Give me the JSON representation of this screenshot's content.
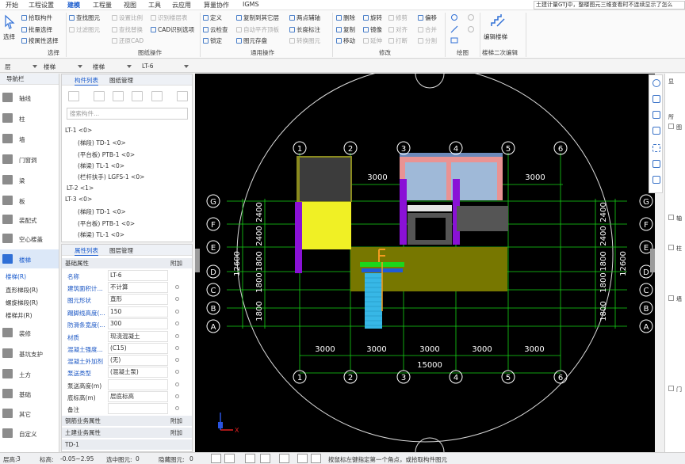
{
  "menu": {
    "tabs": [
      "开始",
      "工程设置",
      "建模",
      "工程量",
      "视图",
      "工具",
      "云应用",
      "算量协作",
      "IGMS"
    ],
    "active": "建模",
    "notice": "土建计量GTJ中，整楼图元三维查看时不连续显示了怎么"
  },
  "ribbon": {
    "select": {
      "big": "选择",
      "items": [
        "拾取构件",
        "批量选择",
        "按属性选择"
      ],
      "label": "选择"
    },
    "drawing": {
      "items": [
        "查找图元",
        "过滤图元",
        "设置比例",
        "还原CAD",
        "识别楼层表",
        "CAD识别选项",
        "查找替换"
      ],
      "label": "图纸操作"
    },
    "common": {
      "items": [
        "定义",
        "云检查",
        "锁定",
        "复制到其它层",
        "自动平齐顶板",
        "图元存盘",
        "两点辅轴",
        "长度标注",
        "转换图元"
      ],
      "label": "通用操作"
    },
    "modify": {
      "items": [
        "删除",
        "旋转",
        "修剪",
        "偏移",
        "复制",
        "镜像",
        "对齐",
        "合并",
        "移动",
        "延伸",
        "打断",
        "分割"
      ],
      "label": "修改"
    },
    "draw": {
      "label": "绘图"
    },
    "stair": {
      "big": "编辑楼梯",
      "label": "楼梯二次编辑"
    }
  },
  "selbar": {
    "items": [
      "层",
      "楼梯",
      "楼梯",
      "LT-6"
    ]
  },
  "nav": {
    "title": "导航栏",
    "items": [
      "轴线",
      "柱",
      "墙",
      "门窗洞",
      "梁",
      "板",
      "装配式",
      "空心楼盖",
      "楼梯"
    ],
    "active": "楼梯",
    "subitems": [
      "楼梯(R)",
      "直形梯段(R)",
      "螺旋梯段(R)",
      "楼梯井(R)"
    ],
    "items2": [
      "装修",
      "基坑支护",
      "土方",
      "基础",
      "其它",
      "自定义"
    ]
  },
  "components": {
    "tabs": [
      "构件列表",
      "图纸管理"
    ],
    "search_placeholder": "搜索构件...",
    "tree": [
      "LT-1 <0>",
      "(梯段) TD-1 <0>",
      "(平台板) PTB-1 <0>",
      "(梯梁) TL-1 <0>",
      "(栏杆扶手) LGFS-1 <0>",
      "LT-2 <1>",
      "LT-3 <0>",
      "(梯段) TD-1 <0>",
      "(平台板) PTB-1 <0>",
      "(梯梁) TL-1 <0>"
    ]
  },
  "properties": {
    "tabs": [
      "属性列表",
      "图层管理"
    ],
    "group": "基础属性",
    "add": "附加",
    "rows": [
      {
        "name": "名称",
        "value": "LT-6"
      },
      {
        "name": "建筑面积计...",
        "value": "不计算"
      },
      {
        "name": "图元形状",
        "value": "直形"
      },
      {
        "name": "踢脚线高度(...",
        "value": "150"
      },
      {
        "name": "防滑条宽度(...",
        "value": "300"
      },
      {
        "name": "材质",
        "value": "现浇混凝土"
      },
      {
        "name": "混凝土强度...",
        "value": "(C15)"
      },
      {
        "name": "混凝土外加剂",
        "value": "(无)"
      },
      {
        "name": "泵送类型",
        "value": "(混凝土泵)"
      },
      {
        "name": "泵送高度(m)",
        "value": ""
      },
      {
        "name": "底标高(m)",
        "value": "层底标高"
      },
      {
        "name": "备注",
        "value": ""
      }
    ],
    "groups2": [
      "钢筋业务属性",
      "土建业务属性",
      "TD-1"
    ]
  },
  "canvas": {
    "top_axes": [
      "1",
      "2",
      "3",
      "4",
      "5",
      "6"
    ],
    "rows": [
      "G",
      "F",
      "E",
      "D",
      "C",
      "B",
      "A"
    ],
    "top_dims": [
      "3000",
      "3000"
    ],
    "bottom_dims": [
      "3000",
      "3000",
      "3000",
      "3000",
      "3000"
    ],
    "total": "15000",
    "left_dims": [
      "2400",
      "2400",
      "1800",
      "1800",
      "1800"
    ],
    "left_total": "12600",
    "ucs": "X"
  },
  "rpanel": {
    "title": "显",
    "items": [
      "所",
      "图",
      "轴",
      "柱",
      "墙",
      "门"
    ]
  },
  "status": {
    "scale_label": "层高:",
    "scale": "3",
    "elev_label": "标高:",
    "elev": "-0.05~2.95",
    "sel_label": "选中图元:",
    "sel": "0",
    "hidden_label": "隐藏图元:",
    "hidden": "0",
    "hint": "按鼠标左键指定第一个角点，或拾取构件图元"
  }
}
